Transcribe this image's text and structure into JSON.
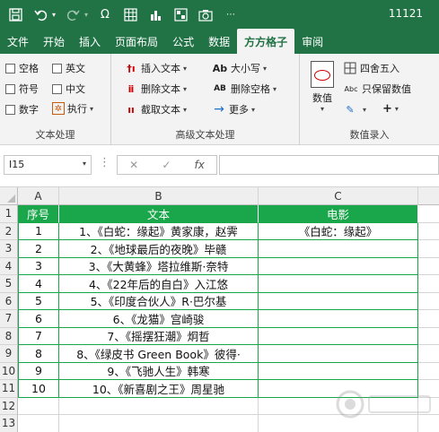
{
  "titlebar": {
    "title": "11121",
    "icons": [
      "save-icon",
      "undo-icon",
      "redo-icon",
      "special-char-icon",
      "table-icon",
      "chart-icon",
      "grid-icon",
      "camera-icon",
      "more-icon"
    ]
  },
  "tabs": [
    "文件",
    "开始",
    "插入",
    "页面布局",
    "公式",
    "数据",
    "方方格子",
    "审阅"
  ],
  "active_tab": "方方格子",
  "ribbon": {
    "group1": {
      "label": "文本处理",
      "items": [
        "空格",
        "英文",
        "符号",
        "中文",
        "数字",
        "执行"
      ]
    },
    "group2": {
      "label": "高级文本处理",
      "items": [
        "插入文本",
        "大小写",
        "删除文本",
        "删除空格",
        "截取文本",
        "更多"
      ],
      "ab_prefix": "Ab",
      "AB_prefix": "AB"
    },
    "group3": {
      "label": "数值录入",
      "items": [
        "数值",
        "四舍五入",
        "只保留数值"
      ],
      "abc_prefix": "Abc"
    }
  },
  "formula_bar": {
    "namebox": "I15",
    "cancel": "✕",
    "confirm": "✓",
    "fx": "fx",
    "value": ""
  },
  "grid": {
    "columns": [
      "A",
      "B",
      "C"
    ],
    "rows": [
      "1",
      "2",
      "3",
      "4",
      "5",
      "6",
      "7",
      "8",
      "9",
      "10",
      "11",
      "12",
      "13"
    ],
    "header": [
      "序号",
      "文本",
      "电影"
    ],
    "data": [
      [
        "1",
        "1、《白蛇：缘起》黄家康，赵霁",
        "《白蛇：缘起》"
      ],
      [
        "2",
        "2、《地球最后的夜晚》毕赣",
        ""
      ],
      [
        "3",
        "3、《大黄蜂》塔拉维斯·奈特",
        ""
      ],
      [
        "4",
        "4、《22年后的自白》入江悠",
        ""
      ],
      [
        "5",
        "5、《印度合伙人》R·巴尔基",
        ""
      ],
      [
        "6",
        "6、《龙猫》宫崎骏",
        ""
      ],
      [
        "7",
        "7、《摇摆狂潮》炯哲",
        ""
      ],
      [
        "8",
        "8、《绿皮书 Green Book》彼得·",
        ""
      ],
      [
        "9",
        "9、《飞驰人生》韩寒",
        ""
      ],
      [
        "10",
        "10、《新喜剧之王》周星驰",
        ""
      ]
    ]
  },
  "colors": {
    "excel_green": "#217346",
    "header_fill": "#1aa64a"
  }
}
